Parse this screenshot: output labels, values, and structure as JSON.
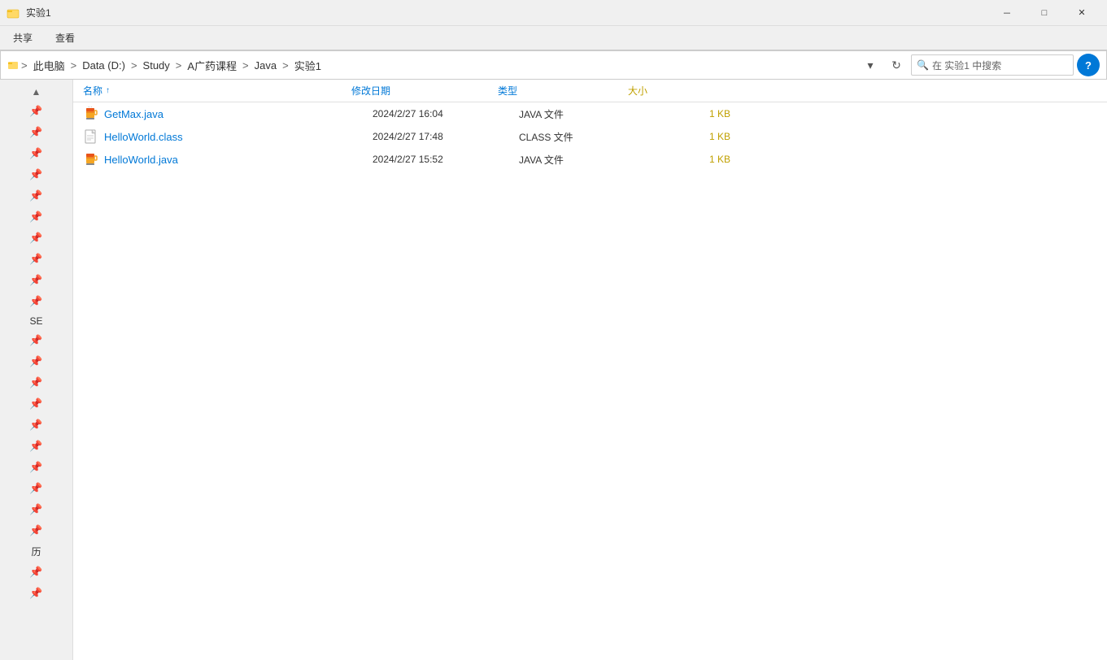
{
  "window": {
    "title": "实验1",
    "minimize_label": "－",
    "maximize_label": "□",
    "close_label": "✕"
  },
  "ribbon": {
    "tabs": [
      "共享",
      "查看"
    ]
  },
  "addressbar": {
    "path_items": [
      "此电脑",
      "Data (D:)",
      "Study",
      "A广药课程",
      "Java",
      "实验1"
    ],
    "search_placeholder": "在 实验1 中搜索",
    "dropdown_btn": "▾",
    "refresh_btn": "↻"
  },
  "columns": {
    "name": "名称",
    "sort_arrow": "↑",
    "date": "修改日期",
    "type": "类型",
    "size": "大小"
  },
  "files": [
    {
      "name": "GetMax.java",
      "icon_type": "java",
      "date": "2024/2/27 16:04",
      "type": "JAVA 文件",
      "size": "1 KB"
    },
    {
      "name": "HelloWorld.class",
      "icon_type": "class",
      "date": "2024/2/27 17:48",
      "type": "CLASS 文件",
      "size": "1 KB"
    },
    {
      "name": "HelloWorld.java",
      "icon_type": "java",
      "date": "2024/2/27 15:52",
      "type": "JAVA 文件",
      "size": "1 KB"
    }
  ],
  "sidebar": {
    "label_se": "SE",
    "label_li": "历"
  },
  "colors": {
    "accent": "#0078d7",
    "size_color": "#c0a000",
    "help_bg": "#0078d7"
  }
}
